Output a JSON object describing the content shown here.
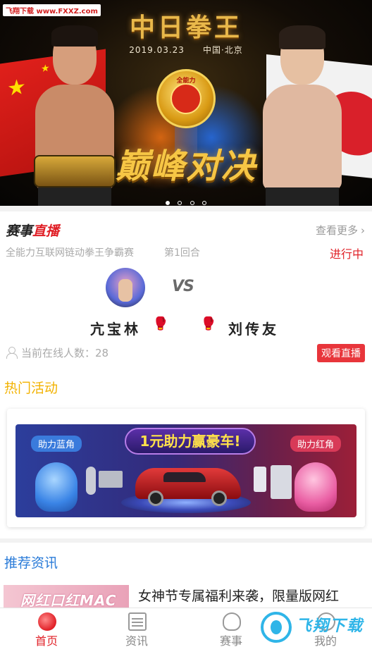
{
  "banner": {
    "watermark": "飞翔下载 www.FXXZ.com",
    "title": "中日拳王",
    "subtitle": "2019.03.23　　中国·北京",
    "emblem_text": "全能力",
    "slogan": "巅峰对决",
    "slides": 4,
    "active_slide": 1
  },
  "live": {
    "heading_prefix": "赛事",
    "heading_highlight": "直播",
    "more_label": "查看更多",
    "match_name": "全能力互联网链动拳王争霸赛",
    "round": "第1回合",
    "status": "进行中",
    "vs_text": "VS",
    "fighter_a": "亢宝林",
    "fighter_b": "刘传友",
    "online_label": "当前在线人数：28",
    "watch_label": "观看直播"
  },
  "hot": {
    "title": "热门活动",
    "promo_title": "1元助力赢豪车!",
    "tag_blue": "助力蓝角",
    "tag_red": "助力红角"
  },
  "news": {
    "title": "推荐资讯",
    "item_image_text": "网红口红MAC",
    "item_text": "女神节专属福利来袭，限量版网红"
  },
  "tabbar": {
    "tabs": [
      {
        "label": "首页",
        "icon": "home-icon",
        "active": true
      },
      {
        "label": "资讯",
        "icon": "news-icon",
        "active": false
      },
      {
        "label": "赛事",
        "icon": "glove-icon",
        "active": false
      },
      {
        "label": "我的",
        "icon": "profile-icon",
        "active": false
      }
    ]
  },
  "site_mark": "飞翔下载",
  "colors": {
    "accent_red": "#e01f26",
    "hot_yellow": "#f2b200",
    "news_blue": "#2a7bd8"
  }
}
